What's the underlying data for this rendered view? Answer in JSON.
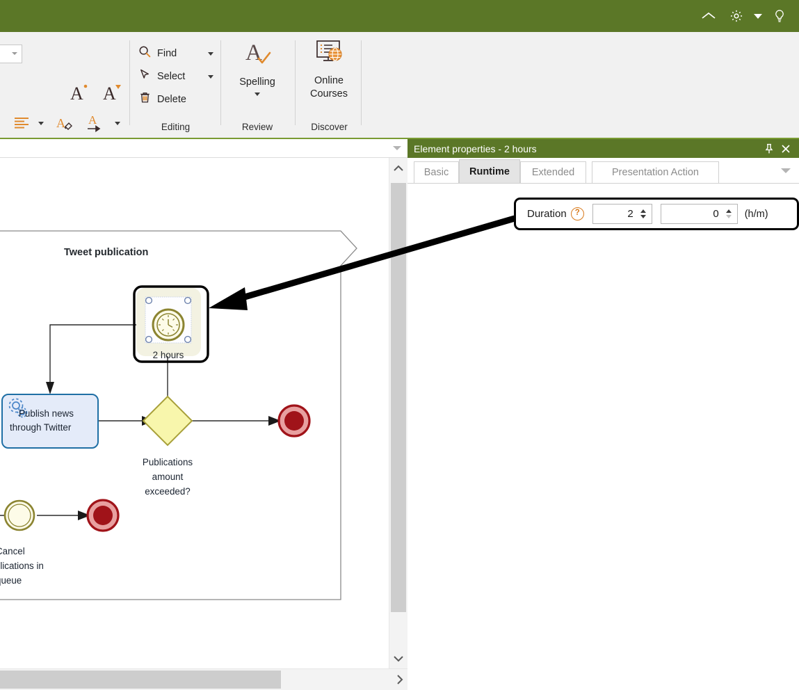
{
  "titlebar": {
    "background": "#5b7727",
    "buttons": [
      {
        "name": "collapse-ribbon",
        "icon": "chevron-up-icon",
        "label": "^"
      },
      {
        "name": "settings",
        "icon": "gear-icon",
        "label": "⚙"
      },
      {
        "name": "settings-dropdown",
        "icon": "chevron-down-icon",
        "label": "▾"
      },
      {
        "name": "tips",
        "icon": "lightbulb-icon",
        "label": "Ω"
      }
    ]
  },
  "ribbon": {
    "groups": [
      {
        "id": "font",
        "label": ""
      },
      {
        "id": "editing",
        "label": "Editing"
      },
      {
        "id": "review",
        "label": "Review"
      },
      {
        "id": "discover",
        "label": "Discover"
      }
    ],
    "font_group": {
      "fontsize_value": "",
      "grow_font": "A",
      "shrink_font": "A",
      "align_label": "",
      "highlight_label": "",
      "fontcolor_label": "A"
    },
    "editing_items": [
      {
        "label": "Find",
        "icon": "search-icon",
        "has_dropdown": true
      },
      {
        "label": "Select",
        "icon": "cursor-arrow-icon",
        "has_dropdown": true
      },
      {
        "label": "Delete",
        "icon": "trash-icon",
        "has_dropdown": false
      }
    ],
    "review_items": [
      {
        "label": "Spelling",
        "icon": "spelling-check-icon",
        "has_dropdown": true
      }
    ],
    "discover_items": [
      {
        "label": "Online\nCourses",
        "line1": "Online",
        "line2": "Courses",
        "icon": "online-courses-icon",
        "has_dropdown": false
      }
    ],
    "group_labels": {
      "editing": "Editing",
      "review": "Review",
      "discover": "Discover"
    }
  },
  "canvas": {
    "dropdown_icon": "chevron-down-icon",
    "vscroll": {
      "up_icon": "chevron-up-icon",
      "down_icon": "chevron-down-icon"
    },
    "hscroll": {
      "right_icon": "chevron-right-icon"
    }
  },
  "diagram": {
    "pool_title": "Tweet publication",
    "nodes": [
      {
        "id": "timer",
        "type": "timer-event",
        "label": "2 hours",
        "selected": true
      },
      {
        "id": "task",
        "type": "service-task",
        "label": "Publish news\nthrough Twitter",
        "line1": "Publish news",
        "line2": "through Twitter"
      },
      {
        "id": "gateway",
        "type": "exclusive-gateway",
        "label": "Publications\namount\nexceeded?",
        "line1": "Publications",
        "line2": "amount",
        "line3": "exceeded?"
      },
      {
        "id": "end1",
        "type": "end-event",
        "label": ""
      },
      {
        "id": "start2",
        "type": "start-event",
        "label": "Cancel\npublications in\nqueue",
        "line1": "Cancel",
        "line2": "publications in",
        "line3": "queue"
      },
      {
        "id": "end2",
        "type": "end-event",
        "label": ""
      }
    ],
    "colors": {
      "task_fill": "#e4ebf9",
      "task_stroke": "#1f6fa5",
      "gateway_fill": "#f8f6ac",
      "gateway_stroke": "#a8a03a",
      "end_fill": "#a01319",
      "end_ring": "#e8a0a0",
      "timer_stroke": "#8b8431",
      "timer_fill": "#fdfbe8"
    }
  },
  "properties": {
    "title": "Element properties - 2 hours",
    "header_buttons": [
      {
        "name": "pin-panel",
        "icon": "pin-icon",
        "label": "⚐"
      },
      {
        "name": "close-panel",
        "icon": "close-icon",
        "label": "✕"
      }
    ],
    "tabs": [
      {
        "label": "Basic",
        "active": false
      },
      {
        "label": "Runtime",
        "active": true
      },
      {
        "label": "Extended",
        "active": false
      },
      {
        "label": "Presentation Action",
        "active": false
      }
    ],
    "tabs_overflow_icon": "chevron-down-icon",
    "duration": {
      "label": "Duration",
      "help_icon": "help-question-icon",
      "hours_value": "2",
      "minutes_value": "0",
      "unit_label": "(h/m)"
    }
  },
  "colors": {
    "brand_green": "#5b7727",
    "accent_orange": "#e08a2e",
    "ribbon_bg": "#f1f1f1"
  }
}
